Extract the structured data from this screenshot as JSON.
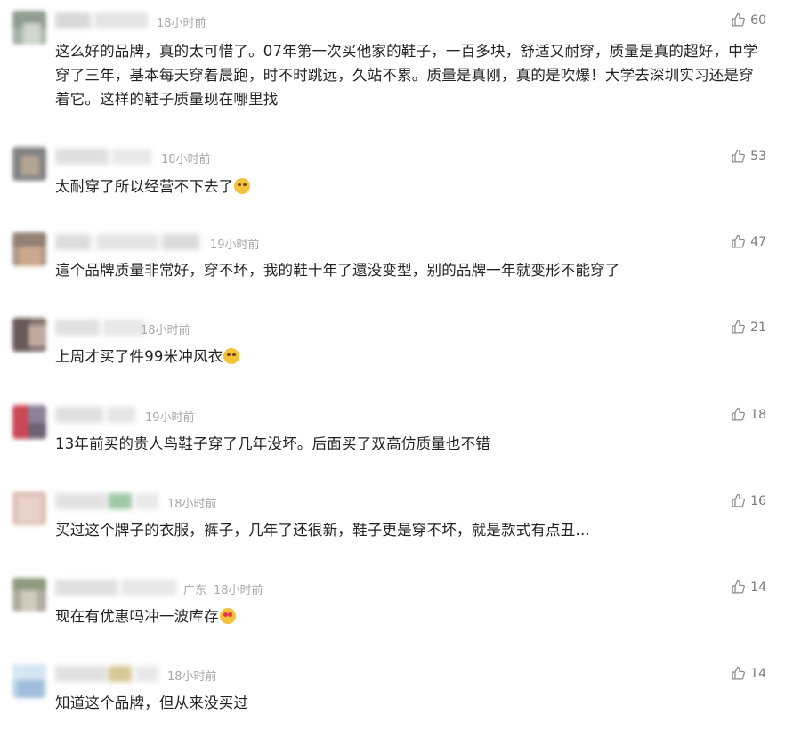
{
  "comments": [
    {
      "time": "18小时前",
      "likes": "60",
      "text": "这么好的品牌，真的太可惜了。07年第一次买他家的鞋子，一百多块，舒适又耐穿，质量是真的超好，中学穿了三年，基本每天穿着晨跑，时不时跳远，久站不累。质量是真刚，真的是吹爆！大学去深圳实习还是穿着它。这样的鞋子质量现在哪里找",
      "emoji": ""
    },
    {
      "time": "18小时前",
      "likes": "53",
      "text": "太耐穿了所以经营不下去了",
      "emoji": "laugh"
    },
    {
      "time": "19小时前",
      "likes": "47",
      "text": "這个品牌质量非常好，穿不坏，我的鞋十年了還没变型，别的品牌一年就变形不能穿了",
      "emoji": ""
    },
    {
      "time": "18小时前",
      "likes": "21",
      "text": "上周才买了件99米冲风衣",
      "emoji": "laugh"
    },
    {
      "time": "19小时前",
      "likes": "18",
      "text": "13年前买的贵人鸟鞋子穿了几年没坏。后面买了双高仿质量也不错",
      "emoji": ""
    },
    {
      "time": "18小时前",
      "likes": "16",
      "text": "买过这个牌子的衣服，裤子，几年了还很新，鞋子更是穿不坏，就是款式有点丑...",
      "emoji": ""
    },
    {
      "location": "广东",
      "time": "18小时前",
      "likes": "14",
      "text": "现在有优惠吗冲一波库存",
      "emoji": "heart"
    },
    {
      "time": "18小时前",
      "likes": "14",
      "text": "知道这个品牌，但从来没买过",
      "emoji": ""
    }
  ]
}
